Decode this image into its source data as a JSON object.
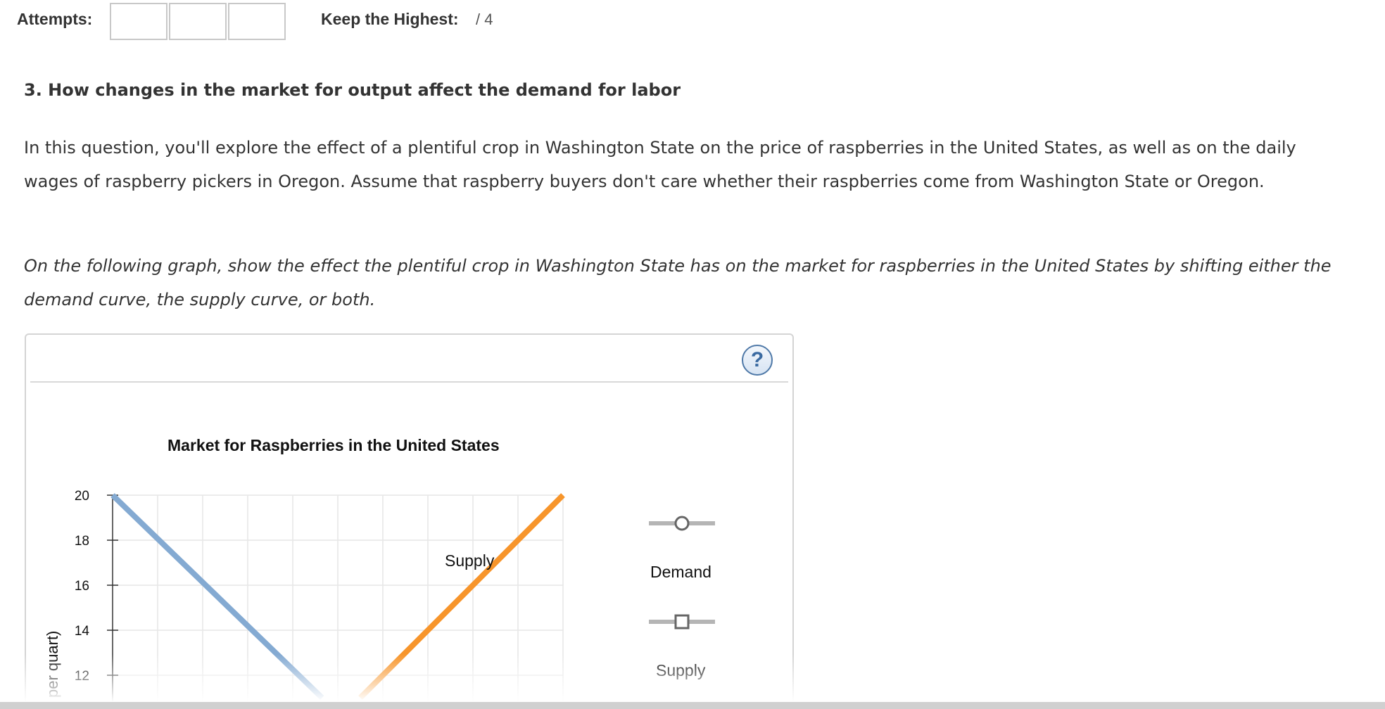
{
  "header": {
    "attempts_label": "Attempts:",
    "keep_label": "Keep the Highest:",
    "keep_value": "/ 4"
  },
  "question": {
    "title": "3. How changes in the market for output affect the demand for labor",
    "body": "In this question, you'll explore the effect of a plentiful crop in Washington State on the price of raspberries in the United States, as well as on the daily wages of raspberry pickers in Oregon. Assume that raspberry buyers don't care whether their raspberries come from Washington State or Oregon.",
    "instruction": "On the following graph, show the effect the plentiful crop in Washington State has on the market for raspberries in the United States by shifting either the demand curve, the supply curve, or both."
  },
  "graph": {
    "help_glyph": "?",
    "legend": {
      "demand_label": "Demand",
      "supply_label": "Supply"
    },
    "curve_label_supply": "Supply",
    "ylabel_visible": "per quart)"
  },
  "colors": {
    "demand": "#84aad2",
    "supply": "#f7952b",
    "grid": "#e6e6e6",
    "handle": "#b5b5b5"
  },
  "chart_data": {
    "type": "line",
    "title": "Market for Raspberries in the United States",
    "ylabel": "per quart)",
    "xlabel": "",
    "ylim": [
      10,
      20
    ],
    "yticks": [
      20,
      18,
      16,
      14,
      12
    ],
    "x_gridlines": 10,
    "series": [
      {
        "name": "Demand",
        "points": [
          [
            0,
            20
          ],
          [
            4.65,
            11
          ]
        ]
      },
      {
        "name": "Supply",
        "points": [
          [
            5.5,
            11
          ],
          [
            10,
            20
          ]
        ]
      }
    ]
  }
}
